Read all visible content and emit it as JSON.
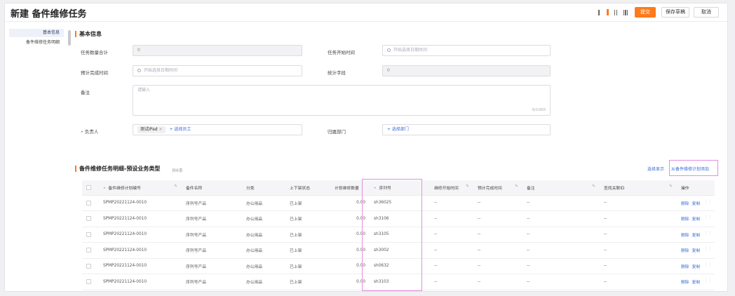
{
  "header": {
    "title": "新建 备件维修任务",
    "buttons": {
      "submit": "提交",
      "save_draft": "保存草稿",
      "cancel": "取消"
    },
    "view_icons": [
      "view-toggle-single-icon",
      "view-toggle-active-icon",
      "view-toggle-double-icon",
      "view-toggle-grid-icon"
    ]
  },
  "sidebar": {
    "items": [
      {
        "label": "基本信息",
        "active": true
      },
      {
        "label": "备件维修任务明细",
        "active": false
      }
    ]
  },
  "basic": {
    "title": "基本信息",
    "task_count_label": "任务数量合计",
    "task_count_value": "0",
    "start_time_label": "任务开始时间",
    "start_time_placeholder": "开始选择日期时间",
    "finish_time_label": "预计完成时间",
    "finish_time_placeholder": "开始选择日期时间",
    "stat_field_label": "统计字段",
    "stat_field_value": "0",
    "remark_label": "备注",
    "remark_placeholder": "请输入",
    "remark_counter": "0/1000",
    "owner_label": "负责人",
    "owner_chip": "测试IPad",
    "owner_chip_close": "×",
    "owner_add": "+ 选择员工",
    "dept_label": "归属部门",
    "dept_add": "+ 选择部门"
  },
  "detail": {
    "title": "备件维修任务明细-预设业务类型",
    "subtitle": "共6条",
    "select_display": "选择显示",
    "from_plan": "从备件维修计划添加",
    "columns": {
      "checkbox": "",
      "plan_no": "备件维修计划编号",
      "name": "备件名称",
      "category": "分类",
      "status": "上下架状态",
      "qty": "计划维修数量",
      "serial": "序列号",
      "repair_start": "维修开始时间",
      "est_finish": "预计完成时间",
      "remark": "备注",
      "related_id": "查找关联ID",
      "ops": "操作"
    },
    "rows": [
      {
        "plan_no": "SPMP20221124-0010",
        "name": "序列号产品",
        "category": "办公用品",
        "status": "已上架",
        "qty": "0.00",
        "serial": "sh36025",
        "repair_start": "--",
        "est_finish": "--",
        "remark": "--",
        "related_id": "--",
        "op_delete": "删除",
        "op_copy": "复制"
      },
      {
        "plan_no": "SPMP20221124-0010",
        "name": "序列号产品",
        "category": "办公用品",
        "status": "已上架",
        "qty": "0.00",
        "serial": "sh3106",
        "repair_start": "--",
        "est_finish": "--",
        "remark": "--",
        "related_id": "--",
        "op_delete": "删除",
        "op_copy": "复制"
      },
      {
        "plan_no": "SPMP20221124-0010",
        "name": "序列号产品",
        "category": "办公用品",
        "status": "已上架",
        "qty": "0.00",
        "serial": "sh3105",
        "repair_start": "--",
        "est_finish": "--",
        "remark": "--",
        "related_id": "--",
        "op_delete": "删除",
        "op_copy": "复制"
      },
      {
        "plan_no": "SPMP20221124-0010",
        "name": "序列号产品",
        "category": "办公用品",
        "status": "已上架",
        "qty": "0.00",
        "serial": "sh3002",
        "repair_start": "--",
        "est_finish": "--",
        "remark": "--",
        "related_id": "--",
        "op_delete": "删除",
        "op_copy": "复制"
      },
      {
        "plan_no": "SPMP20221124-0010",
        "name": "序列号产品",
        "category": "办公用品",
        "status": "已上架",
        "qty": "0.00",
        "serial": "sh0632",
        "repair_start": "--",
        "est_finish": "--",
        "remark": "--",
        "related_id": "--",
        "op_delete": "删除",
        "op_copy": "复制"
      },
      {
        "plan_no": "SPMP20221124-0010",
        "name": "序列号产品",
        "category": "办公用品",
        "status": "已上架",
        "qty": "0.00",
        "serial": "sh3103",
        "repair_start": "--",
        "est_finish": "--",
        "remark": "--",
        "related_id": "--",
        "op_delete": "删除",
        "op_copy": "复制"
      }
    ]
  },
  "colors": {
    "accent": "#ff7a1a",
    "link": "#3a6bd6",
    "highlight": "#e58ee0"
  }
}
